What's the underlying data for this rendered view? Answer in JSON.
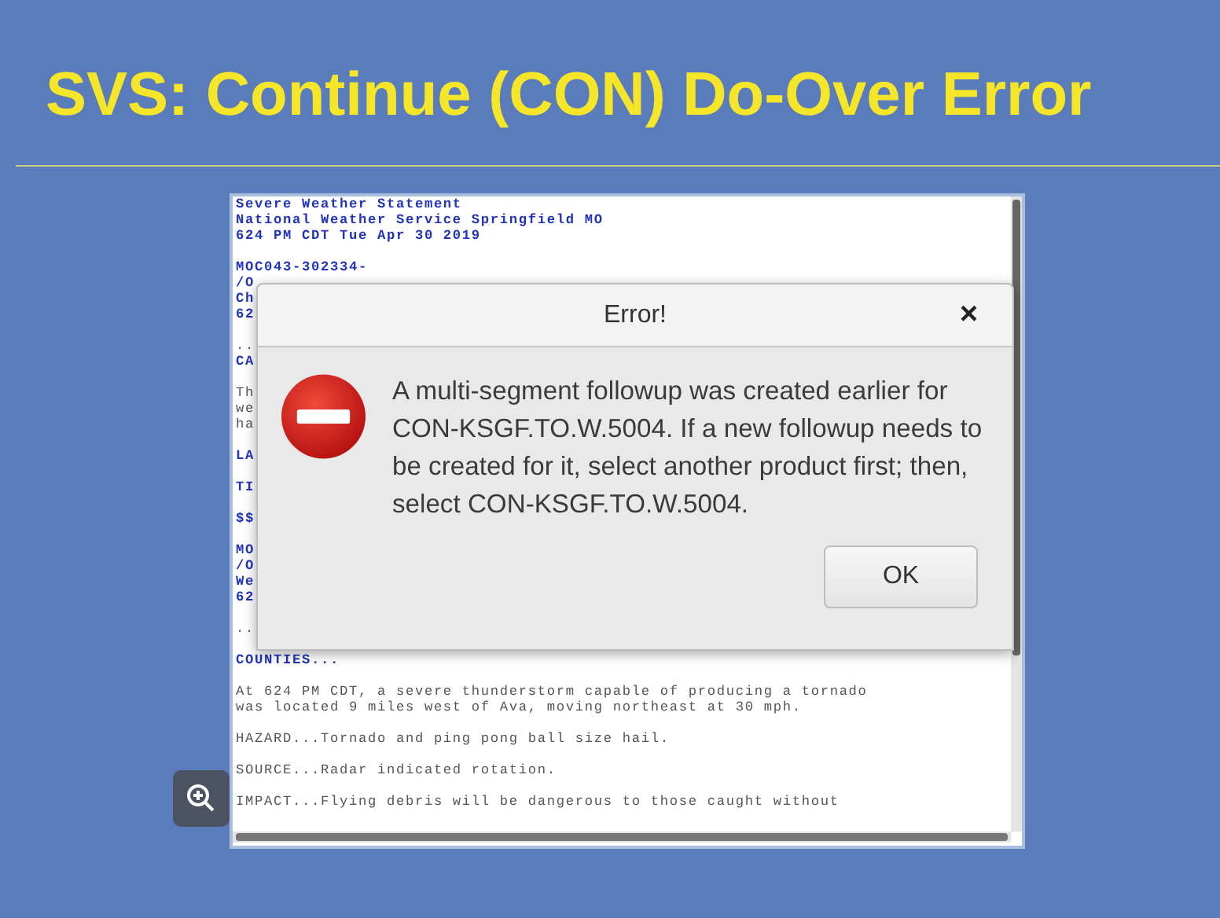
{
  "slide": {
    "title": "SVS: Continue (CON) Do-Over Error"
  },
  "product_text": {
    "paragraphs": [
      {
        "lines": [
          {
            "text": "Severe Weather Statement",
            "kind": "header"
          },
          {
            "text": "National Weather Service Springfield MO",
            "kind": "header"
          },
          {
            "text": "624 PM CDT Tue Apr 30 2019",
            "kind": "header"
          }
        ]
      },
      {
        "lines": [
          {
            "text": "MOC043-302334-",
            "kind": "header"
          },
          {
            "text": "/O",
            "kind": "header"
          },
          {
            "text": "Ch",
            "kind": "header"
          },
          {
            "text": "62",
            "kind": "header"
          }
        ]
      },
      {
        "lines": [
          {
            "text": "..",
            "kind": "body"
          },
          {
            "text": "CA",
            "kind": "header"
          }
        ]
      },
      {
        "lines": [
          {
            "text": "Th",
            "kind": "body"
          },
          {
            "text": "we",
            "kind": "body"
          },
          {
            "text": "ha",
            "kind": "body"
          }
        ]
      },
      {
        "lines": [
          {
            "text": "LA",
            "kind": "header"
          }
        ]
      },
      {
        "lines": [
          {
            "text": "TI",
            "kind": "header"
          }
        ]
      },
      {
        "lines": [
          {
            "text": "$$",
            "kind": "header"
          }
        ]
      },
      {
        "lines": [
          {
            "text": "MO",
            "kind": "header"
          },
          {
            "text": "/O",
            "kind": "header"
          },
          {
            "text": "We",
            "kind": "header"
          },
          {
            "text": "62",
            "kind": "header"
          }
        ]
      },
      {
        "lines": [
          {
            "text": "..",
            "kind": "body"
          }
        ]
      },
      {
        "lines": [
          {
            "text": "COUNTIES...",
            "kind": "header"
          }
        ]
      },
      {
        "lines": [
          {
            "text": "At 624 PM CDT, a severe thunderstorm capable of producing a tornado",
            "kind": "body"
          },
          {
            "text": "was located 9 miles west of Ava, moving northeast at 30 mph.",
            "kind": "body"
          }
        ]
      },
      {
        "lines": [
          {
            "text": "HAZARD...Tornado and ping pong ball size hail.",
            "kind": "body"
          }
        ]
      },
      {
        "lines": [
          {
            "text": "SOURCE...Radar indicated rotation.",
            "kind": "body"
          }
        ]
      },
      {
        "lines": [
          {
            "text": "IMPACT...Flying debris will be dangerous to those caught without",
            "kind": "body"
          }
        ]
      }
    ]
  },
  "dialog": {
    "title": "Error!",
    "close": "×",
    "message": "A multi-segment followup was created earlier for CON-KSGF.TO.W.5004. If a new followup needs to be created for it, select another product first; then, select CON-KSGF.TO.W.5004.",
    "buttons": [
      "OK"
    ]
  }
}
